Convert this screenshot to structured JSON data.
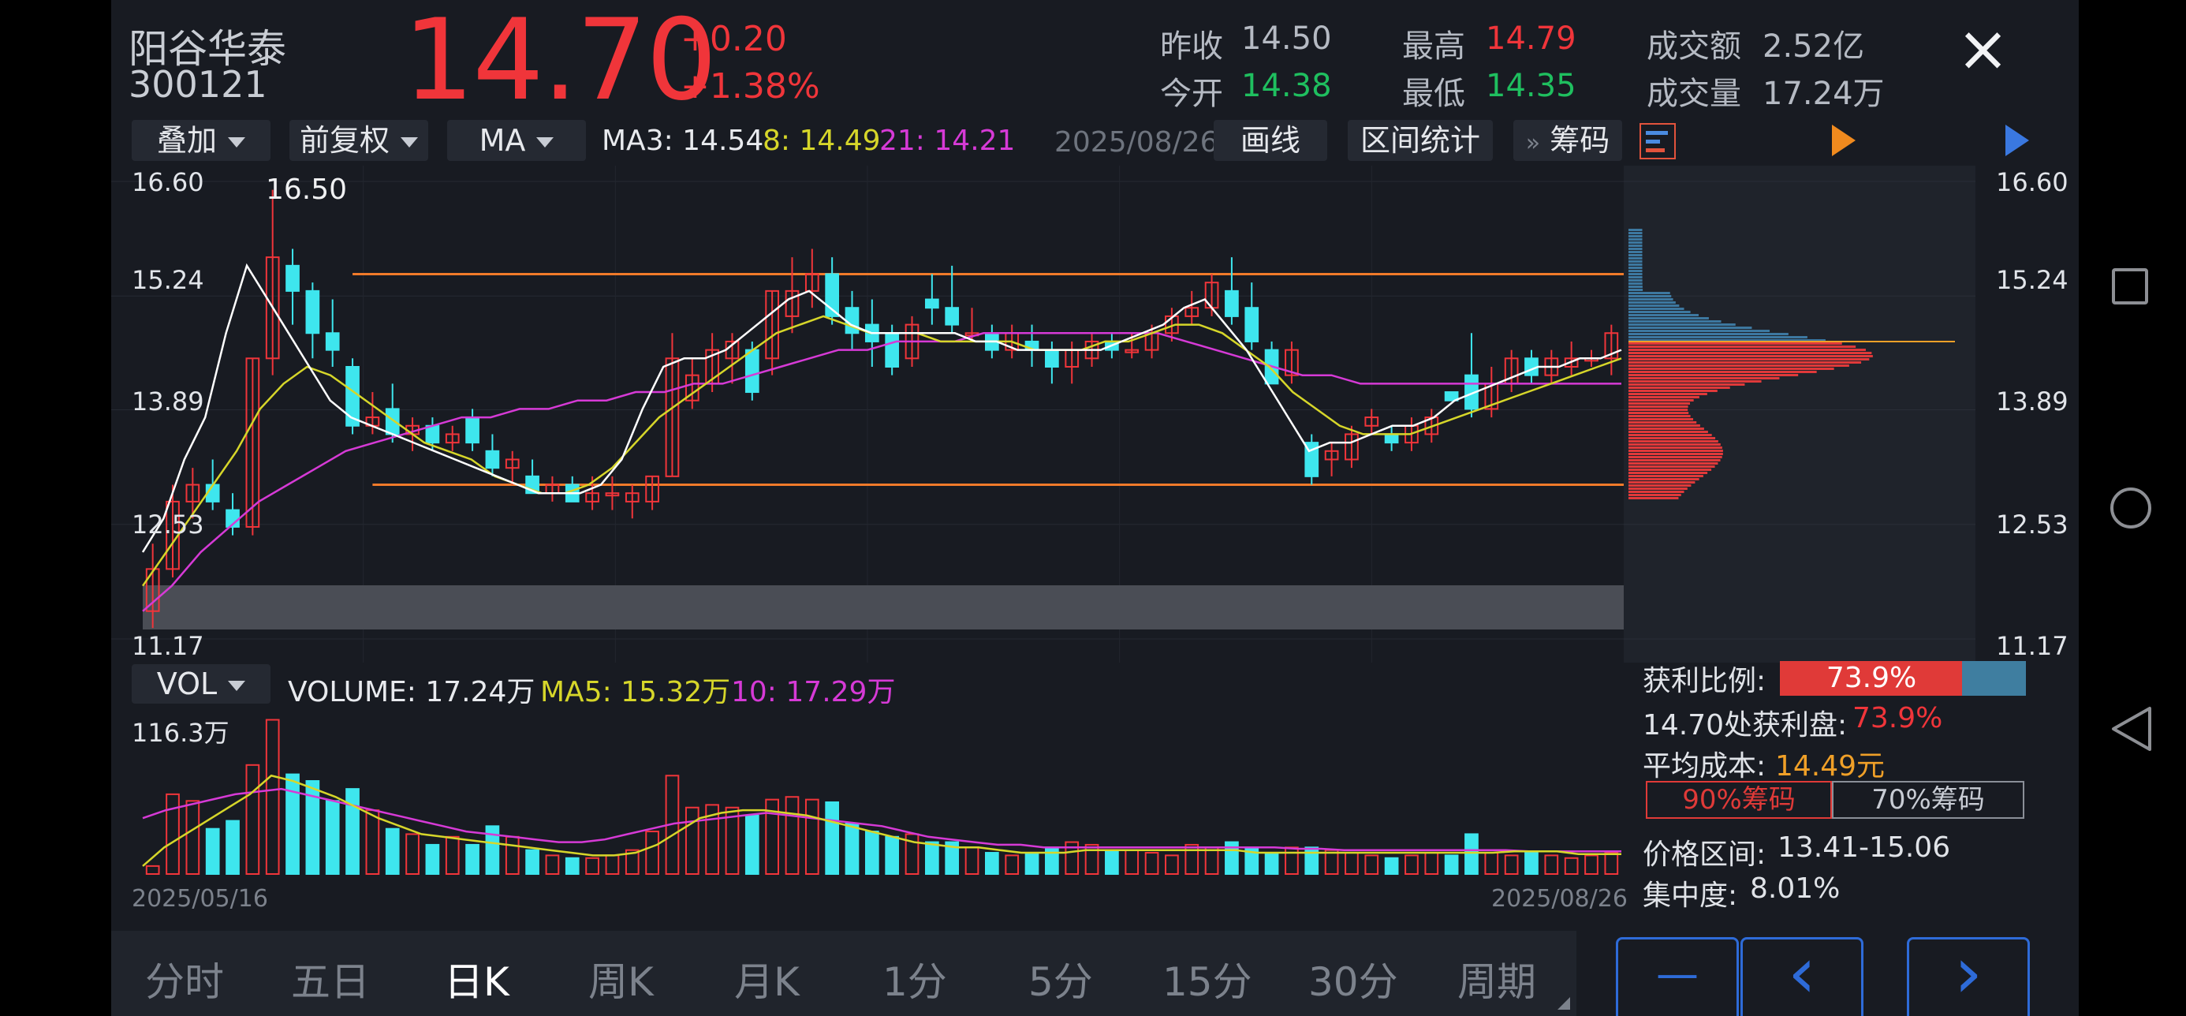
{
  "stock": {
    "name": "阳谷华泰",
    "code": "300121",
    "price": "14.70",
    "change": "+0.20",
    "change_pct": "+1.38%"
  },
  "quote": {
    "prev_close_label": "昨收",
    "prev_close": "14.50",
    "open_label": "今开",
    "open": "14.38",
    "high_label": "最高",
    "high": "14.79",
    "low_label": "最低",
    "low": "14.35",
    "amount_label": "成交额",
    "amount": "2.52亿",
    "volume_label": "成交量",
    "volume": "17.24万"
  },
  "toolbar": {
    "overlay": "叠加",
    "adjust": "前复权",
    "indicator": "MA",
    "ma3": "MA3: 14.54",
    "ma8": "8: 14.49",
    "ma21": "21: 14.21",
    "date": "2025/08/26",
    "draw": "画线",
    "range_stats": "区间统计",
    "chips_arrow": "»",
    "chips": "筹码"
  },
  "price_axis": [
    "16.60",
    "15.24",
    "13.89",
    "12.53",
    "11.17"
  ],
  "peak_label": "16.50",
  "vol_toolbar": {
    "indicator": "VOL",
    "volume": "VOLUME: 17.24万",
    "ma5": "MA5: 15.32万",
    "ma10": "10: 17.29万"
  },
  "vol_axis_max": "116.3万",
  "dates": {
    "start": "2025/05/16",
    "end": "2025/08/26"
  },
  "chip_panel": {
    "profit_ratio_label": "获利比例:",
    "profit_ratio": "73.9%",
    "profit_ratio_value": 0.739,
    "profit_at_label": "14.70处获利盘:",
    "profit_at": "73.9%",
    "avg_cost_label": "平均成本:",
    "avg_cost": "14.49元",
    "btn_90": "90%筹码",
    "btn_70": "70%筹码",
    "range_label": "价格区间:",
    "range": "13.41-15.06",
    "concentration_label": "集中度:",
    "concentration": "8.01%"
  },
  "tabs": [
    "分时",
    "五日",
    "日K",
    "周K",
    "月K",
    "1分",
    "5分",
    "15分",
    "30分",
    "周期"
  ],
  "active_tab": "日K",
  "nav": {
    "minus": "—",
    "prev": "‹",
    "next": "›"
  },
  "close_icon": "×",
  "colors": {
    "up": "#f0353a",
    "down": "#3ee6ee",
    "ma3": "#ffffff",
    "ma8": "#d6d62a",
    "ma21": "#d63ad6",
    "accent": "#2e6bd8"
  },
  "chart_data": {
    "type": "candlestick",
    "x_range": [
      "2025/05/16",
      "2025/08/26"
    ],
    "ylim": [
      11.17,
      16.6
    ],
    "candles": [
      [
        11.5,
        12.0,
        11.3,
        12.3
      ],
      [
        12.0,
        12.8,
        11.9,
        13.0
      ],
      [
        12.8,
        13.0,
        12.6,
        13.2
      ],
      [
        13.0,
        12.8,
        12.7,
        13.3
      ],
      [
        12.7,
        12.5,
        12.4,
        12.9
      ],
      [
        12.5,
        14.5,
        12.4,
        14.5
      ],
      [
        14.5,
        15.7,
        14.3,
        16.5
      ],
      [
        15.6,
        15.3,
        14.9,
        15.8
      ],
      [
        15.3,
        14.8,
        14.5,
        15.4
      ],
      [
        14.8,
        14.6,
        14.4,
        15.2
      ],
      [
        14.4,
        13.7,
        13.6,
        14.5
      ],
      [
        13.7,
        13.8,
        13.6,
        14.1
      ],
      [
        13.9,
        13.6,
        13.5,
        14.2
      ],
      [
        13.6,
        13.7,
        13.4,
        13.8
      ],
      [
        13.7,
        13.5,
        13.4,
        13.8
      ],
      [
        13.5,
        13.6,
        13.4,
        13.7
      ],
      [
        13.8,
        13.5,
        13.4,
        13.9
      ],
      [
        13.4,
        13.2,
        13.1,
        13.6
      ],
      [
        13.2,
        13.3,
        13.0,
        13.4
      ],
      [
        13.1,
        12.9,
        12.9,
        13.3
      ],
      [
        12.9,
        13.0,
        12.8,
        13.1
      ],
      [
        13.0,
        12.8,
        12.8,
        13.1
      ],
      [
        12.8,
        12.9,
        12.7,
        13.1
      ],
      [
        12.9,
        12.9,
        12.7,
        13.1
      ],
      [
        12.8,
        12.9,
        12.6,
        13.0
      ],
      [
        12.8,
        13.1,
        12.7,
        13.1
      ],
      [
        13.1,
        14.5,
        13.1,
        14.8
      ],
      [
        14.0,
        14.3,
        13.9,
        14.5
      ],
      [
        14.2,
        14.6,
        14.1,
        14.8
      ],
      [
        14.5,
        14.7,
        14.2,
        14.8
      ],
      [
        14.6,
        14.1,
        14.0,
        14.7
      ],
      [
        14.5,
        15.3,
        14.3,
        15.3
      ],
      [
        15.0,
        15.3,
        14.8,
        15.7
      ],
      [
        15.3,
        15.5,
        15.1,
        15.8
      ],
      [
        15.5,
        15.0,
        14.9,
        15.7
      ],
      [
        15.1,
        14.8,
        14.6,
        15.3
      ],
      [
        14.9,
        14.7,
        14.4,
        15.2
      ],
      [
        14.8,
        14.4,
        14.3,
        14.9
      ],
      [
        14.5,
        14.9,
        14.4,
        15.0
      ],
      [
        15.2,
        15.1,
        14.9,
        15.5
      ],
      [
        15.1,
        14.9,
        14.8,
        15.6
      ],
      [
        14.8,
        14.8,
        14.7,
        15.1
      ],
      [
        14.8,
        14.6,
        14.5,
        14.9
      ],
      [
        14.6,
        14.8,
        14.5,
        14.9
      ],
      [
        14.7,
        14.6,
        14.4,
        14.9
      ],
      [
        14.6,
        14.4,
        14.2,
        14.7
      ],
      [
        14.4,
        14.6,
        14.2,
        14.7
      ],
      [
        14.5,
        14.7,
        14.4,
        14.8
      ],
      [
        14.7,
        14.6,
        14.5,
        14.8
      ],
      [
        14.6,
        14.6,
        14.5,
        14.8
      ],
      [
        14.6,
        14.8,
        14.5,
        14.9
      ],
      [
        14.8,
        15.0,
        14.7,
        15.1
      ],
      [
        15.0,
        15.1,
        14.9,
        15.3
      ],
      [
        15.1,
        15.4,
        15.0,
        15.5
      ],
      [
        15.3,
        15.0,
        14.9,
        15.7
      ],
      [
        15.1,
        14.7,
        14.6,
        15.4
      ],
      [
        14.6,
        14.2,
        14.2,
        14.7
      ],
      [
        14.3,
        14.6,
        14.2,
        14.7
      ],
      [
        13.5,
        13.1,
        13.0,
        13.6
      ],
      [
        13.3,
        13.4,
        13.1,
        13.5
      ],
      [
        13.3,
        13.6,
        13.2,
        13.7
      ],
      [
        13.7,
        13.8,
        13.6,
        13.9
      ],
      [
        13.6,
        13.5,
        13.4,
        13.7
      ],
      [
        13.5,
        13.7,
        13.4,
        13.8
      ],
      [
        13.6,
        13.8,
        13.5,
        13.9
      ],
      [
        14.1,
        14.0,
        14.0,
        14.1
      ],
      [
        14.3,
        13.9,
        13.8,
        14.8
      ],
      [
        13.9,
        14.2,
        13.8,
        14.4
      ],
      [
        14.2,
        14.5,
        14.1,
        14.6
      ],
      [
        14.5,
        14.3,
        14.2,
        14.6
      ],
      [
        14.3,
        14.5,
        14.2,
        14.6
      ],
      [
        14.4,
        14.5,
        14.3,
        14.7
      ],
      [
        14.5,
        14.5,
        14.4,
        14.6
      ],
      [
        14.5,
        14.8,
        14.3,
        14.9
      ]
    ],
    "ma3": [
      12.2,
      12.6,
      13.3,
      13.8,
      14.8,
      15.6,
      15.2,
      14.8,
      14.4,
      14.0,
      13.8,
      13.7,
      13.6,
      13.5,
      13.4,
      13.3,
      13.2,
      13.1,
      13.0,
      12.9,
      12.9,
      12.9,
      13.0,
      13.3,
      13.9,
      14.4,
      14.5,
      14.5,
      14.6,
      14.8,
      15.0,
      15.2,
      15.3,
      15.1,
      14.9,
      14.8,
      14.8,
      14.8,
      14.8,
      14.8,
      14.7,
      14.7,
      14.6,
      14.6,
      14.6,
      14.6,
      14.6,
      14.7,
      14.8,
      14.9,
      15.1,
      15.2,
      14.9,
      14.6,
      14.2,
      13.8,
      13.4,
      13.5,
      13.5,
      13.6,
      13.7,
      13.7,
      13.8,
      14.0,
      14.1,
      14.2,
      14.3,
      14.4,
      14.4,
      14.5,
      14.5,
      14.6
    ],
    "ma8": [
      11.8,
      12.2,
      12.6,
      13.0,
      13.4,
      13.9,
      14.2,
      14.4,
      14.3,
      14.1,
      13.9,
      13.7,
      13.5,
      13.4,
      13.3,
      13.1,
      13.0,
      12.9,
      12.9,
      13.0,
      13.2,
      13.5,
      13.8,
      14.0,
      14.2,
      14.4,
      14.6,
      14.8,
      14.9,
      15.0,
      14.9,
      14.8,
      14.8,
      14.8,
      14.7,
      14.7,
      14.7,
      14.7,
      14.6,
      14.6,
      14.6,
      14.7,
      14.7,
      14.8,
      14.9,
      14.9,
      14.8,
      14.6,
      14.4,
      14.1,
      13.9,
      13.7,
      13.6,
      13.6,
      13.6,
      13.7,
      13.8,
      13.9,
      14.0,
      14.1,
      14.2,
      14.3,
      14.4,
      14.5
    ],
    "ma21": [
      11.5,
      11.8,
      12.2,
      12.5,
      12.8,
      13.0,
      13.2,
      13.4,
      13.5,
      13.6,
      13.7,
      13.8,
      13.8,
      13.9,
      13.9,
      14.0,
      14.0,
      14.1,
      14.1,
      14.2,
      14.2,
      14.3,
      14.4,
      14.5,
      14.6,
      14.6,
      14.7,
      14.7,
      14.7,
      14.8,
      14.8,
      14.8,
      14.8,
      14.8,
      14.8,
      14.8,
      14.7,
      14.6,
      14.5,
      14.4,
      14.3,
      14.3,
      14.2,
      14.2,
      14.2,
      14.2,
      14.2,
      14.2,
      14.2,
      14.2,
      14.2,
      14.2
    ],
    "support_line": 13.0,
    "resistance_line": 15.5,
    "volume_ylim": [
      0,
      116.3
    ],
    "volume": [
      6,
      60,
      55,
      34,
      40,
      82,
      116,
      75,
      70,
      55,
      64,
      48,
      34,
      30,
      22,
      28,
      22,
      36,
      28,
      18,
      14,
      12,
      12,
      14,
      18,
      32,
      74,
      50,
      52,
      50,
      44,
      56,
      58,
      56,
      54,
      38,
      32,
      28,
      30,
      24,
      24,
      20,
      16,
      14,
      16,
      20,
      24,
      22,
      18,
      18,
      16,
      14,
      22,
      20,
      24,
      20,
      16,
      20,
      20,
      18,
      16,
      14,
      12,
      14,
      16,
      14,
      30,
      16,
      14,
      16,
      14,
      12,
      14,
      16
    ],
    "volume_ma5": [
      6,
      20,
      30,
      40,
      50,
      60,
      74,
      70,
      64,
      58,
      50,
      42,
      36,
      30,
      28,
      26,
      24,
      22,
      20,
      18,
      16,
      14,
      14,
      16,
      22,
      32,
      42,
      46,
      48,
      48,
      46,
      44,
      40,
      36,
      32,
      28,
      24,
      22,
      20,
      20,
      18,
      16,
      16,
      16,
      18,
      18,
      18,
      18,
      18,
      18,
      18,
      18,
      16,
      16,
      16,
      16,
      16,
      16,
      16,
      16,
      16,
      16,
      16,
      16,
      17,
      17,
      17,
      15,
      15,
      15
    ],
    "volume_ma10": [
      42,
      48,
      52,
      56,
      60,
      62,
      64,
      60,
      56,
      52,
      48,
      44,
      40,
      36,
      32,
      30,
      28,
      26,
      24,
      24,
      26,
      30,
      34,
      38,
      40,
      42,
      44,
      46,
      44,
      42,
      40,
      38,
      36,
      32,
      28,
      26,
      24,
      22,
      22,
      20,
      20,
      20,
      20,
      20,
      20,
      20,
      20,
      20,
      20,
      20,
      19,
      19,
      18,
      18,
      18,
      18,
      18,
      18,
      18,
      18,
      17,
      17,
      17,
      17,
      17
    ]
  }
}
